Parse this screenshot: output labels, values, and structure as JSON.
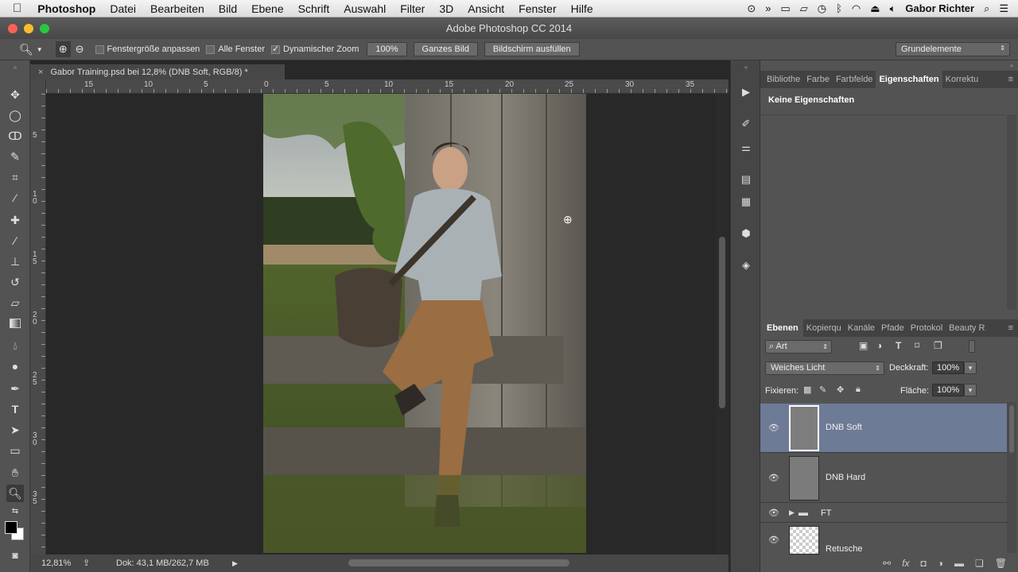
{
  "menubar": {
    "app_name": "Photoshop",
    "items": [
      "Datei",
      "Bearbeiten",
      "Bild",
      "Ebene",
      "Schrift",
      "Auswahl",
      "Filter",
      "3D",
      "Ansicht",
      "Fenster",
      "Hilfe"
    ],
    "user": "Gabor Richter"
  },
  "window": {
    "title": "Adobe Photoshop CC 2014"
  },
  "options": {
    "fit_window_label": "Fenstergröße anpassen",
    "all_windows_label": "Alle Fenster",
    "dynamic_zoom_label": "Dynamischer Zoom",
    "zoom_100_button": "100%",
    "fit_screen_button": "Ganzes Bild",
    "fill_screen_button": "Bildschirm ausfüllen",
    "workspace": "Grundelemente"
  },
  "document": {
    "tab_title": "Gabor Training.psd bei 12,8% (DNB Soft, RGB/8) *",
    "ruler_h": [
      "15",
      "10",
      "5",
      "0",
      "5",
      "10",
      "15",
      "20",
      "25",
      "30",
      "35"
    ],
    "ruler_v": [
      "5",
      "10",
      "15",
      "20",
      "25",
      "30",
      "35"
    ]
  },
  "status": {
    "zoom": "12,81%",
    "doc_size": "Dok: 43,1 MB/262,7 MB"
  },
  "properties_panel": {
    "tabs": [
      "Bibliothe",
      "Farbe",
      "Farbfelde",
      "Eigenschaften",
      "Korrektu"
    ],
    "active_tab": "Eigenschaften",
    "message": "Keine Eigenschaften"
  },
  "layers_panel": {
    "tabs": [
      "Ebenen",
      "Kopierqu",
      "Kanäle",
      "Pfade",
      "Protokol",
      "Beauty R"
    ],
    "filter_kind": "Art",
    "blend_mode": "Weiches Licht",
    "opacity_label": "Deckkraft:",
    "opacity_value": "100%",
    "lock_label": "Fixieren:",
    "fill_label": "Fläche:",
    "fill_value": "100%",
    "layers": [
      {
        "name": "DNB Soft",
        "selected": true
      },
      {
        "name": "DNB Hard",
        "selected": false
      },
      {
        "name": "FT",
        "selected": false
      },
      {
        "name": "Retusche",
        "selected": false
      }
    ]
  },
  "colors": {
    "selection": "#6e7b96",
    "panel": "#535353",
    "canvas_bg": "#282828"
  }
}
